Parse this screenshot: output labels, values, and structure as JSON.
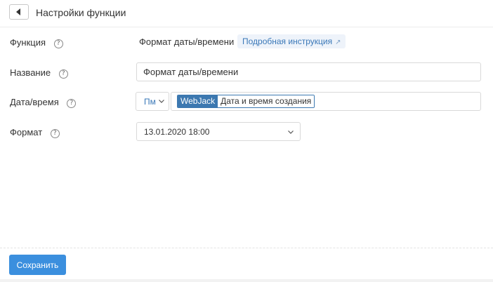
{
  "header": {
    "title": "Настройки функции",
    "back_icon": "back-arrow-icon"
  },
  "form": {
    "function": {
      "label": "Функция",
      "value": "Формат даты/времени",
      "doc_link": "Подробная инструкция",
      "link_icon": "external-link-icon"
    },
    "name": {
      "label": "Название",
      "value": "Формат даты/времени"
    },
    "datetime": {
      "label": "Дата/время",
      "variable_button": "Пм",
      "tag_source": "WebJack",
      "tag_value": "Дата и время создания"
    },
    "format": {
      "label": "Формат",
      "selected": "13.01.2020 18:00"
    },
    "help_glyph": "?"
  },
  "footer": {
    "save_label": "Сохранить"
  },
  "colors": {
    "accent": "#3b8fde",
    "link": "#3a78b8",
    "tag": "#3c78b0"
  }
}
